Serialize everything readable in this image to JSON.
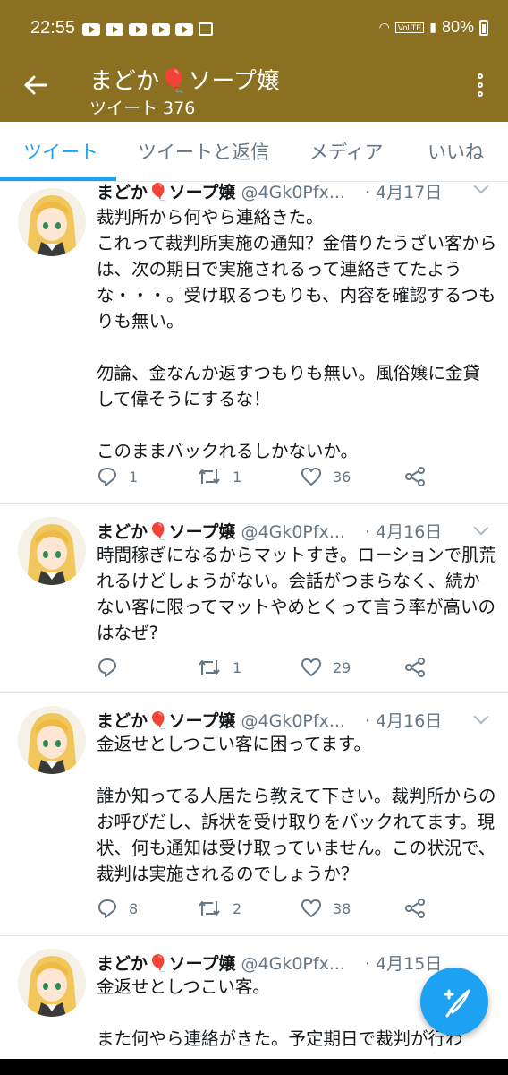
{
  "status": {
    "time": "22:55",
    "battery": "80%",
    "volte": "VoLTE"
  },
  "header": {
    "title": "まどか🎈ソープ嬢",
    "subtitle": "ツイート 376"
  },
  "tabs": [
    {
      "label": "ツイート"
    },
    {
      "label": "ツイートと返信"
    },
    {
      "label": "メディア"
    },
    {
      "label": "いいね"
    }
  ],
  "tweets": [
    {
      "name": "まどか🎈ソープ嬢",
      "handle": "@4Gk0Pfx...",
      "date": "· 4月17日",
      "text": "裁判所から何やら連絡きた。\nこれって裁判所実施の通知？金借りたうざい客からは、次の期日で実施されるって連絡きてたような・・・。受け取るつもりも、内容を確認するつもりも無い。\n\n勿論、金なんか返すつもりも無い。風俗嬢に金貸して偉そうにするな！\n\nこのままバックれるしかないか。",
      "replies": "1",
      "retweets": "1",
      "likes": "36"
    },
    {
      "name": "まどか🎈ソープ嬢",
      "handle": "@4Gk0Pfx...",
      "date": "· 4月16日",
      "text": "時間稼ぎになるからマットすき。ローションで肌荒れるけどしょうがない。会話がつまらなく、続かない客に限ってマットやめとくって言う率が高いのはなぜ?",
      "replies": "",
      "retweets": "1",
      "likes": "29"
    },
    {
      "name": "まどか🎈ソープ嬢",
      "handle": "@4Gk0Pfx...",
      "date": "· 4月16日",
      "text": "金返せとしつこい客に困ってます。\n\n誰か知ってる人居たら教えて下さい。裁判所からのお呼びだし、訴状を受け取りをバックれてます。現状、何も通知は受け取っていません。この状況で、裁判は実施されるのでしょうか？",
      "replies": "8",
      "retweets": "2",
      "likes": "38"
    },
    {
      "name": "まどか🎈ソープ嬢",
      "handle": "@4Gk0Pfx...",
      "date": "· 4月15日",
      "text": "金返せとしつこい客。\n\nまた何やら連絡がきた。予定期日で裁判が行わ",
      "replies": "",
      "retweets": "",
      "likes": ""
    }
  ],
  "colors": {
    "header": "#8a7020",
    "accent": "#1da1f2",
    "muted": "#657786"
  }
}
